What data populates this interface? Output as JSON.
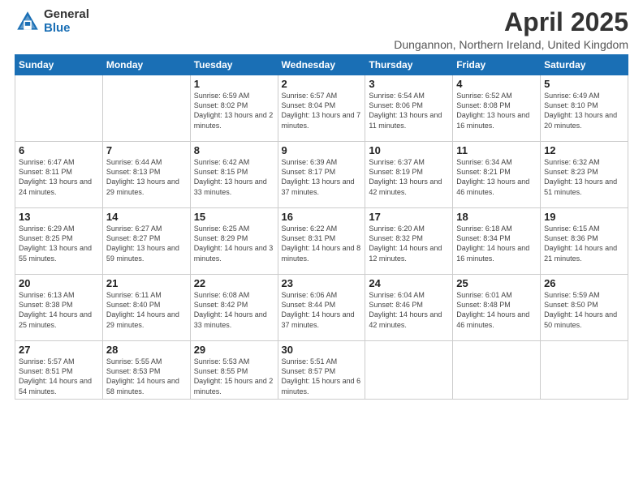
{
  "logo": {
    "general": "General",
    "blue": "Blue"
  },
  "title": "April 2025",
  "location": "Dungannon, Northern Ireland, United Kingdom",
  "days_of_week": [
    "Sunday",
    "Monday",
    "Tuesday",
    "Wednesday",
    "Thursday",
    "Friday",
    "Saturday"
  ],
  "weeks": [
    [
      {
        "day": "",
        "info": ""
      },
      {
        "day": "",
        "info": ""
      },
      {
        "day": "1",
        "info": "Sunrise: 6:59 AM\nSunset: 8:02 PM\nDaylight: 13 hours and 2 minutes."
      },
      {
        "day": "2",
        "info": "Sunrise: 6:57 AM\nSunset: 8:04 PM\nDaylight: 13 hours and 7 minutes."
      },
      {
        "day": "3",
        "info": "Sunrise: 6:54 AM\nSunset: 8:06 PM\nDaylight: 13 hours and 11 minutes."
      },
      {
        "day": "4",
        "info": "Sunrise: 6:52 AM\nSunset: 8:08 PM\nDaylight: 13 hours and 16 minutes."
      },
      {
        "day": "5",
        "info": "Sunrise: 6:49 AM\nSunset: 8:10 PM\nDaylight: 13 hours and 20 minutes."
      }
    ],
    [
      {
        "day": "6",
        "info": "Sunrise: 6:47 AM\nSunset: 8:11 PM\nDaylight: 13 hours and 24 minutes."
      },
      {
        "day": "7",
        "info": "Sunrise: 6:44 AM\nSunset: 8:13 PM\nDaylight: 13 hours and 29 minutes."
      },
      {
        "day": "8",
        "info": "Sunrise: 6:42 AM\nSunset: 8:15 PM\nDaylight: 13 hours and 33 minutes."
      },
      {
        "day": "9",
        "info": "Sunrise: 6:39 AM\nSunset: 8:17 PM\nDaylight: 13 hours and 37 minutes."
      },
      {
        "day": "10",
        "info": "Sunrise: 6:37 AM\nSunset: 8:19 PM\nDaylight: 13 hours and 42 minutes."
      },
      {
        "day": "11",
        "info": "Sunrise: 6:34 AM\nSunset: 8:21 PM\nDaylight: 13 hours and 46 minutes."
      },
      {
        "day": "12",
        "info": "Sunrise: 6:32 AM\nSunset: 8:23 PM\nDaylight: 13 hours and 51 minutes."
      }
    ],
    [
      {
        "day": "13",
        "info": "Sunrise: 6:29 AM\nSunset: 8:25 PM\nDaylight: 13 hours and 55 minutes."
      },
      {
        "day": "14",
        "info": "Sunrise: 6:27 AM\nSunset: 8:27 PM\nDaylight: 13 hours and 59 minutes."
      },
      {
        "day": "15",
        "info": "Sunrise: 6:25 AM\nSunset: 8:29 PM\nDaylight: 14 hours and 3 minutes."
      },
      {
        "day": "16",
        "info": "Sunrise: 6:22 AM\nSunset: 8:31 PM\nDaylight: 14 hours and 8 minutes."
      },
      {
        "day": "17",
        "info": "Sunrise: 6:20 AM\nSunset: 8:32 PM\nDaylight: 14 hours and 12 minutes."
      },
      {
        "day": "18",
        "info": "Sunrise: 6:18 AM\nSunset: 8:34 PM\nDaylight: 14 hours and 16 minutes."
      },
      {
        "day": "19",
        "info": "Sunrise: 6:15 AM\nSunset: 8:36 PM\nDaylight: 14 hours and 21 minutes."
      }
    ],
    [
      {
        "day": "20",
        "info": "Sunrise: 6:13 AM\nSunset: 8:38 PM\nDaylight: 14 hours and 25 minutes."
      },
      {
        "day": "21",
        "info": "Sunrise: 6:11 AM\nSunset: 8:40 PM\nDaylight: 14 hours and 29 minutes."
      },
      {
        "day": "22",
        "info": "Sunrise: 6:08 AM\nSunset: 8:42 PM\nDaylight: 14 hours and 33 minutes."
      },
      {
        "day": "23",
        "info": "Sunrise: 6:06 AM\nSunset: 8:44 PM\nDaylight: 14 hours and 37 minutes."
      },
      {
        "day": "24",
        "info": "Sunrise: 6:04 AM\nSunset: 8:46 PM\nDaylight: 14 hours and 42 minutes."
      },
      {
        "day": "25",
        "info": "Sunrise: 6:01 AM\nSunset: 8:48 PM\nDaylight: 14 hours and 46 minutes."
      },
      {
        "day": "26",
        "info": "Sunrise: 5:59 AM\nSunset: 8:50 PM\nDaylight: 14 hours and 50 minutes."
      }
    ],
    [
      {
        "day": "27",
        "info": "Sunrise: 5:57 AM\nSunset: 8:51 PM\nDaylight: 14 hours and 54 minutes."
      },
      {
        "day": "28",
        "info": "Sunrise: 5:55 AM\nSunset: 8:53 PM\nDaylight: 14 hours and 58 minutes."
      },
      {
        "day": "29",
        "info": "Sunrise: 5:53 AM\nSunset: 8:55 PM\nDaylight: 15 hours and 2 minutes."
      },
      {
        "day": "30",
        "info": "Sunrise: 5:51 AM\nSunset: 8:57 PM\nDaylight: 15 hours and 6 minutes."
      },
      {
        "day": "",
        "info": ""
      },
      {
        "day": "",
        "info": ""
      },
      {
        "day": "",
        "info": ""
      }
    ]
  ]
}
